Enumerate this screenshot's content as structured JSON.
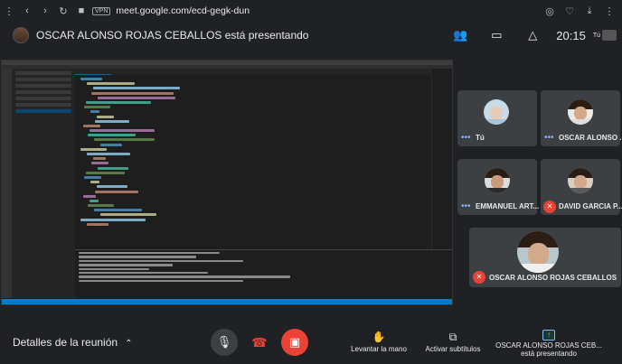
{
  "browser": {
    "url": "meet.google.com/ecd-gegk-dun",
    "vpn_label": "VPN"
  },
  "header": {
    "presenter_title": "OSCAR ALONSO ROJAS CEBALLOS está presentando",
    "clock": "20:15",
    "self_label": "Tú"
  },
  "participants": [
    {
      "name": "Tú",
      "muted": false
    },
    {
      "name": "OSCAR ALONSO ...",
      "muted": false
    },
    {
      "name": "EMMANUEL ART...",
      "muted": false
    },
    {
      "name": "DAVID GARCIA P...",
      "muted": true
    }
  ],
  "presenter_tile": {
    "name": "OSCAR ALONSO ROJAS CEBALLOS",
    "muted": true
  },
  "bottom": {
    "details_label": "Detalles de la reunión",
    "raise_hand_label": "Levantar la mano",
    "captions_label": "Activar subtítulos",
    "presenting_name": "OSCAR ALONSO ROJAS CEB...",
    "presenting_status": "está presentando"
  },
  "icons": {
    "mic": "mic-off-icon",
    "hangup": "hang-up-icon",
    "camera": "camera-off-icon",
    "raise_hand": "hand-icon",
    "captions": "captions-icon",
    "presenting": "present-screen-icon"
  },
  "colors": {
    "background": "#202124",
    "tile": "#3c4043",
    "danger": "#ea4335",
    "accent": "#8ab4f8"
  }
}
